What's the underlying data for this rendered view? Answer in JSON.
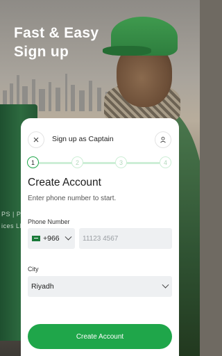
{
  "hero": {
    "title_line1": "Fast & Easy",
    "title_line2": "Sign up"
  },
  "background": {
    "truck_text_line1": "PS | PA",
    "truck_text_line2": "ices LLC"
  },
  "header": {
    "title": "Sign up as Captain",
    "close_icon": "close-icon",
    "profile_icon": "person-icon"
  },
  "stepper": {
    "steps": [
      "1",
      "2",
      "3",
      "4"
    ],
    "active_step": 1
  },
  "form": {
    "title": "Create Account",
    "subtitle": "Enter phone number to start.",
    "phone": {
      "label": "Phone Number",
      "country_code": "+966",
      "country_flag": "saudi-arabia-flag",
      "placeholder": "11123 4567"
    },
    "city": {
      "label": "City",
      "value": "Riyadh"
    },
    "submit_label": "Create Account"
  },
  "colors": {
    "accent": "#1fa64a",
    "step_track": "#cdeed6",
    "input_bg": "#eef0f2"
  }
}
